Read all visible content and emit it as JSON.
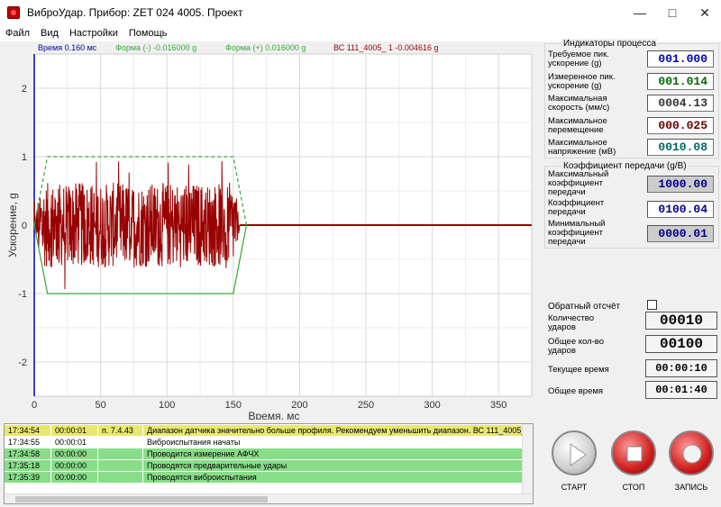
{
  "window": {
    "title": "ВиброУдар. Прибор: ZET 024 4005. Проект",
    "minimize_icon": "minimize-icon",
    "maximize_icon": "maximize-icon",
    "close_icon": "close-icon"
  },
  "menu": [
    "Файл",
    "Вид",
    "Настройки",
    "Помощь"
  ],
  "legend": {
    "time": "Время 0.160 мс",
    "form_minus": "Форма (-) -0.016000 g",
    "form_plus": "Форма (+) 0.016000 g",
    "sensor": "ВС 111_4005_ 1 -0.004616 g"
  },
  "chart_data": {
    "type": "line",
    "xlabel": "Время, мс",
    "ylabel": "Ускорение, g",
    "xlim": [
      0,
      375
    ],
    "ylim": [
      -2.5,
      2.5
    ],
    "xticks": [
      0,
      50,
      100,
      150,
      200,
      250,
      300,
      350
    ],
    "yticks": [
      -2,
      -1,
      0,
      1,
      2
    ],
    "grid": true,
    "series": [
      {
        "name": "Форма (+)",
        "color": "#33aa33",
        "style": "dashed",
        "x": [
          0,
          10,
          150,
          160
        ],
        "y": [
          0,
          1,
          1,
          0
        ]
      },
      {
        "name": "Форма (-)",
        "color": "#33aa33",
        "style": "solid",
        "x": [
          0,
          10,
          150,
          160
        ],
        "y": [
          0,
          -1,
          -1,
          0
        ]
      },
      {
        "name": "ВС 111_4005_ 1",
        "color": "#990000",
        "style": "solid",
        "note_signal_extent_ms": [
          0,
          155
        ],
        "amplitude": 1.0
      }
    ]
  },
  "indicators": {
    "title": "Индикаторы процесса",
    "rows": [
      {
        "label1": "Требуемое пик.",
        "label2": "ускорение (g)",
        "value": "001.000",
        "color": "#0000aa"
      },
      {
        "label1": "Измеренное пик.",
        "label2": "ускорение (g)",
        "value": "001.014",
        "color": "#006600"
      },
      {
        "label1": "Максимальная",
        "label2": "скорость (мм/с)",
        "value": "0004.13",
        "color": "#333333"
      },
      {
        "label1": "Максимальное",
        "label2": "перемещение",
        "value": "000.025",
        "color": "#660000"
      },
      {
        "label1": "Максимальное",
        "label2": "напряжение (мВ)",
        "value": "0010.08",
        "color": "#006666"
      }
    ]
  },
  "coef": {
    "title": "Коэффициент передачи (g/В)",
    "rows": [
      {
        "label": [
          "Максимальный",
          "коэффициент",
          "передачи"
        ],
        "value": "1000.00",
        "bg": "#cccccc"
      },
      {
        "label": [
          "Коэффициент",
          "передачи"
        ],
        "value": "0100.04",
        "bg": "#ffffff"
      },
      {
        "label": [
          "Минимальный",
          "коэффициент",
          "передачи"
        ],
        "value": "0000.01",
        "bg": "#cccccc"
      }
    ]
  },
  "controls": {
    "reverse_label": "Обратный отсчёт",
    "reverse_checked": false,
    "count_label": [
      "Количество",
      "ударов"
    ],
    "count_value": "00010",
    "total_label": [
      "Общее кол-во",
      "ударов"
    ],
    "total_value": "00100",
    "cur_time_label": "Текущее время",
    "cur_time_value": "00:00:10",
    "total_time_label": "Общее время",
    "total_time_value": "00:01:40"
  },
  "log": [
    {
      "time": "17:34:54",
      "dur": "00:00:01",
      "code": "п. 7.4.43",
      "msg": "Диапазон датчика значительно больше профиля. Рекомендуем уменьшить диапазон. ВС 111_4005_",
      "bg": "#e8e870"
    },
    {
      "time": "17:34:55",
      "dur": "00:00:01",
      "code": "",
      "msg": "Виброиспытания начаты",
      "bg": "#ffffff"
    },
    {
      "time": "17:34:58",
      "dur": "00:00:00",
      "code": "",
      "msg": "Проводится измерение АФЧХ",
      "bg": "#88dd88"
    },
    {
      "time": "17:35:18",
      "dur": "00:00:00",
      "code": "",
      "msg": "Проводятся предварительные удары",
      "bg": "#88dd88"
    },
    {
      "time": "17:35:39",
      "dur": "00:00:00",
      "code": "",
      "msg": "Проводятся виброиспытания",
      "bg": "#88dd88"
    }
  ],
  "buttons": {
    "start": "СТАРТ",
    "stop": "СТОП",
    "record": "ЗАПИСЬ"
  }
}
